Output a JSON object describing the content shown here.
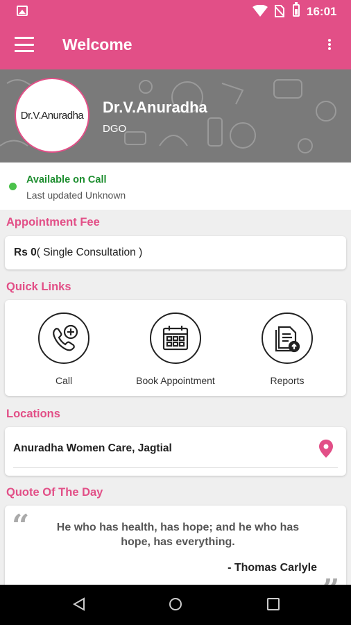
{
  "statusbar": {
    "time": "16:01"
  },
  "appbar": {
    "title": "Welcome"
  },
  "profile": {
    "avatar_text": "Dr.V.Anuradha",
    "name": "Dr.V.Anuradha",
    "designation": "DGO"
  },
  "availability": {
    "status": "Available on Call",
    "last_updated": "Last updated Unknown",
    "status_color": "#4bc24b"
  },
  "appointment_fee": {
    "label": "Appointment Fee",
    "amount": "Rs 0",
    "note": "( Single Consultation )"
  },
  "quick_links": {
    "label": "Quick Links",
    "items": [
      {
        "label": "Call",
        "icon": "call-icon"
      },
      {
        "label": "Book Appointment",
        "icon": "calendar-icon"
      },
      {
        "label": "Reports",
        "icon": "report-icon"
      }
    ]
  },
  "locations": {
    "label": "Locations",
    "items": [
      {
        "name": "Anuradha Women Care, Jagtial"
      }
    ]
  },
  "quote": {
    "label": "Quote Of The Day",
    "text": "He who has health, has hope; and he who has hope, has everything.",
    "author": "- Thomas Carlyle"
  },
  "theme": {
    "accent": "#e24f87"
  }
}
